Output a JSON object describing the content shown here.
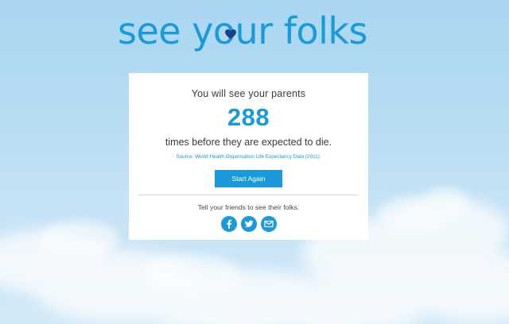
{
  "logo": {
    "text": "see your folks"
  },
  "result": {
    "intro": "You will see your parents",
    "count": "288",
    "outro": "times before they are expected to die.",
    "source": "Source: World Health Organisation Life Expectancy Data (2011)."
  },
  "actions": {
    "start_again_label": "Start Again"
  },
  "share": {
    "prompt": "Tell your friends to see their folks.",
    "icons": [
      "facebook-icon",
      "twitter-icon",
      "email-icon"
    ]
  },
  "colors": {
    "brand_blue": "#1a9ad8",
    "sky_top": "#a9d6f2",
    "text_dark": "#3b3b3b"
  }
}
